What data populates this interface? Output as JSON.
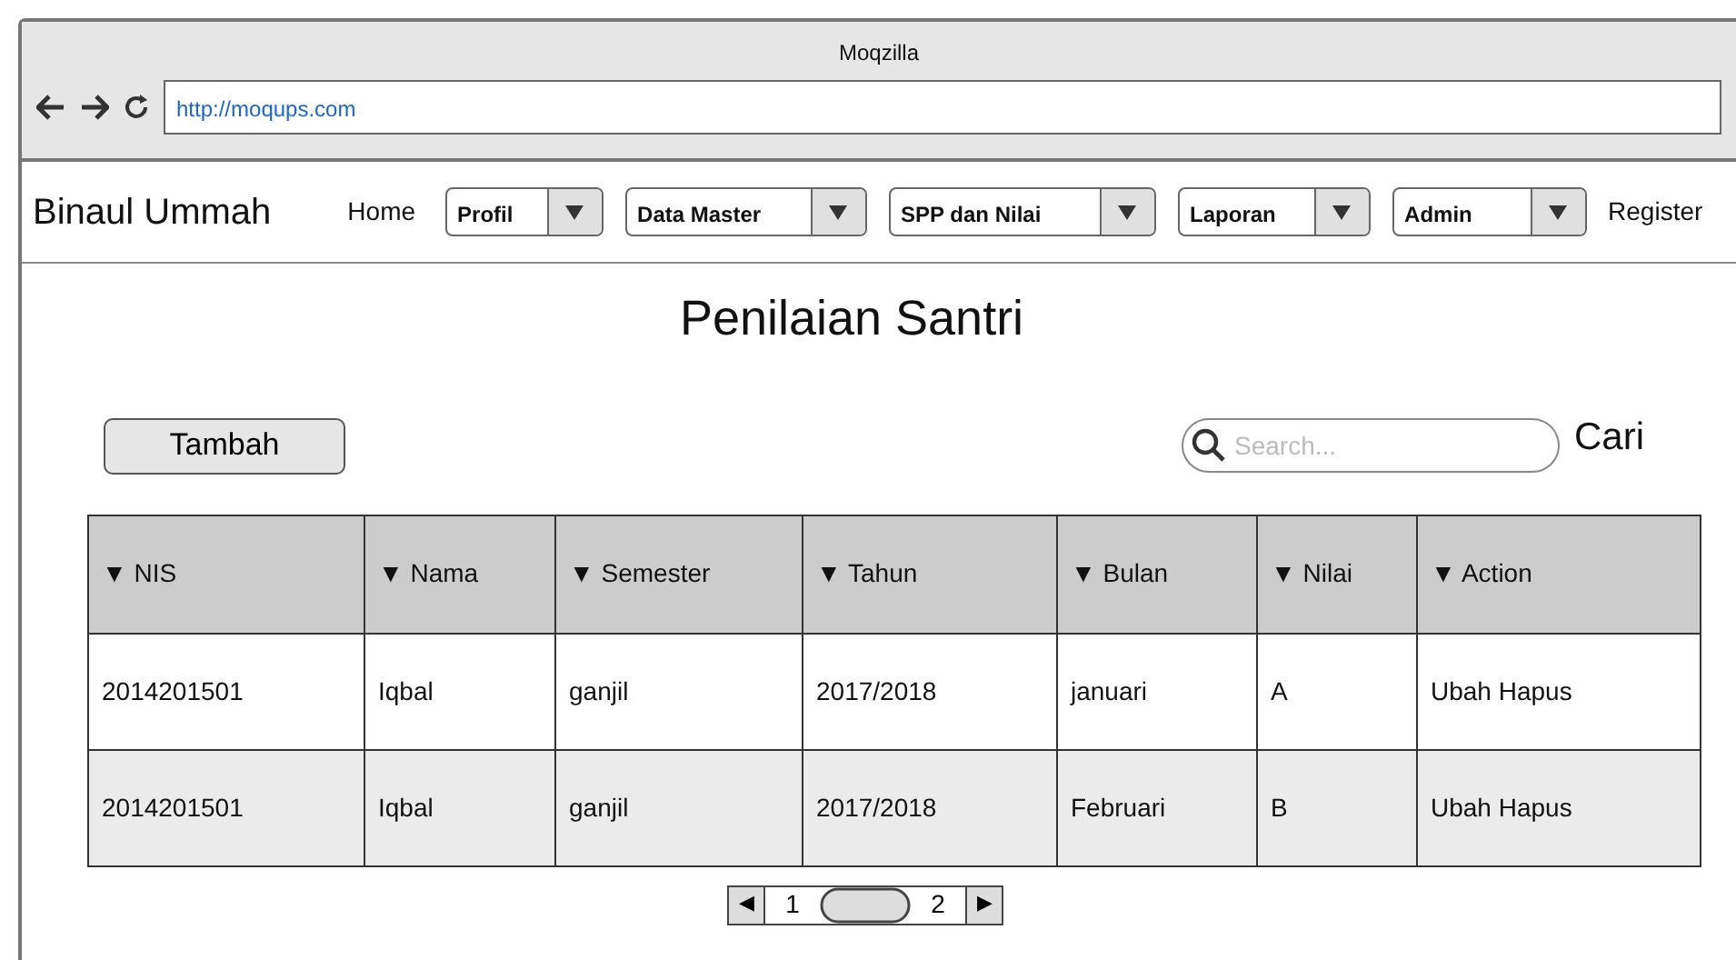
{
  "window": {
    "title": "Moqzilla",
    "url": "http://moqups.com"
  },
  "navbar": {
    "brand": "Binaul Ummah",
    "items": [
      {
        "kind": "link",
        "label": "Home"
      },
      {
        "kind": "dropdown",
        "label": "Profil"
      },
      {
        "kind": "dropdown",
        "label": "Data Master"
      },
      {
        "kind": "dropdown",
        "label": "SPP dan Nilai"
      },
      {
        "kind": "dropdown",
        "label": "Laporan"
      },
      {
        "kind": "dropdown",
        "label": "Admin"
      },
      {
        "kind": "link",
        "label": "Register"
      }
    ]
  },
  "page": {
    "title": "Penilaian Santri",
    "add_button": "Tambah",
    "search": {
      "placeholder": "Search..."
    },
    "search_label": "Cari"
  },
  "table": {
    "columns": [
      "▼ NIS",
      "▼ Nama",
      "▼ Semester",
      "▼ Tahun",
      "▼ Bulan",
      "▼ Nilai",
      "▼ Action"
    ],
    "rows": [
      [
        "2014201501",
        "Iqbal",
        "ganjil",
        "2017/2018",
        "januari",
        "A",
        "Ubah Hapus"
      ],
      [
        "2014201501",
        "Iqbal",
        "ganjil",
        "2017/2018",
        "Februari",
        "B",
        "Ubah Hapus"
      ]
    ]
  },
  "pager": {
    "prev": "◀",
    "pages": [
      "1",
      "2"
    ],
    "next": "▶"
  }
}
